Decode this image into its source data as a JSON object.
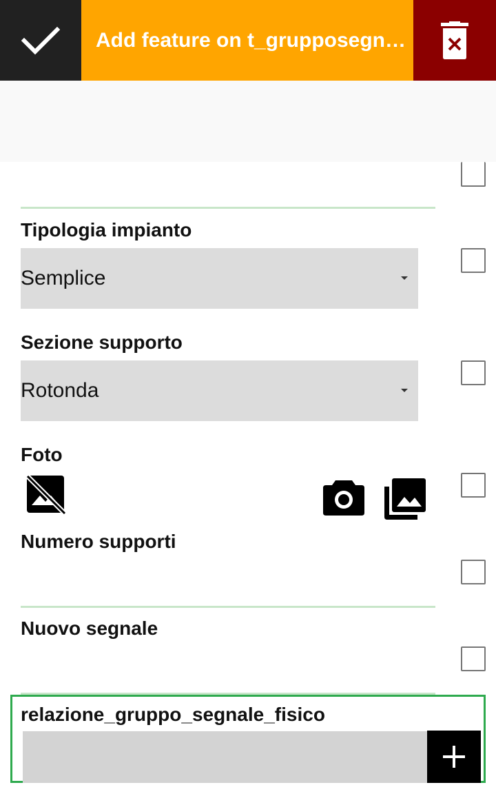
{
  "toolbar": {
    "title": "Add feature on t_grupposegnale_fisico",
    "confirm_icon": "check-icon",
    "delete_icon": "trash-icon",
    "colors": {
      "confirm_bg": "#212121",
      "title_bg": "#FFA500",
      "delete_bg": "#8B0000"
    }
  },
  "fields": {
    "tipologia": {
      "label": "Tipologia impianto",
      "value": "Semplice"
    },
    "sezione": {
      "label": "Sezione supporto",
      "value": "Rotonda"
    },
    "foto": {
      "label": "Foto",
      "icons": [
        "no-image-icon",
        "camera-icon",
        "gallery-icon"
      ]
    },
    "numero_supporti": {
      "label": "Numero supporti"
    },
    "nuovo_segnale": {
      "label": "Nuovo segnale"
    },
    "relazione": {
      "label": "relazione_gruppo_segnale_fisico",
      "add_icon": "plus-icon"
    }
  },
  "accent_colors": {
    "divider": "#c8e6c9",
    "relation_border": "#2EAA4E"
  }
}
